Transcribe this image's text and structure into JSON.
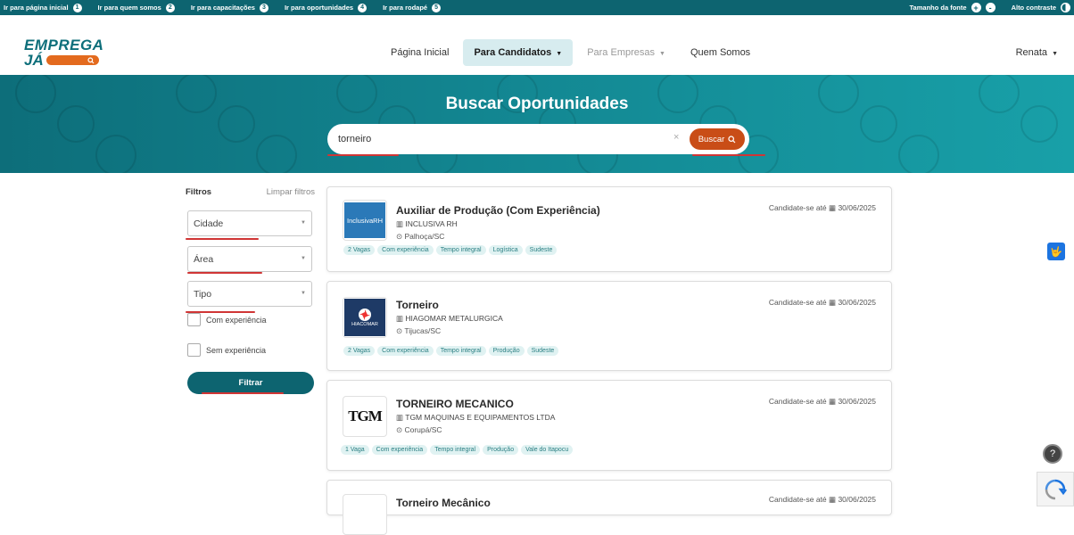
{
  "accessibility_bar": {
    "links": [
      {
        "label": "Ir para página inicial",
        "num": "1"
      },
      {
        "label": "Ir para quem somos",
        "num": "2"
      },
      {
        "label": "Ir para capacitações",
        "num": "3"
      },
      {
        "label": "Ir para oportunidades",
        "num": "4"
      },
      {
        "label": "Ir para rodapé",
        "num": "5"
      }
    ],
    "font_size_label": "Tamanho da fonte",
    "font_increase": "+",
    "font_decrease": "-",
    "contrast_label": "Alto contraste"
  },
  "header": {
    "logo_top": "EMPREGA",
    "logo_bottom": "JÁ",
    "nav": [
      {
        "label": "Página Inicial",
        "caret": ""
      },
      {
        "label": "Para Candidatos",
        "caret": "▼"
      },
      {
        "label": "Para Empresas",
        "caret": "▼"
      },
      {
        "label": "Quem Somos",
        "caret": ""
      }
    ],
    "user": "Renata",
    "user_caret": "▼"
  },
  "hero": {
    "title": "Buscar Oportunidades",
    "search_value": "torneiro",
    "clear_icon": "×",
    "search_button": "Buscar"
  },
  "filters": {
    "title": "Filtros",
    "clear": "Limpar filtros",
    "city": "Cidade",
    "area": "Área",
    "type": "Tipo",
    "with_experience": "Com experiência",
    "without_experience": "Sem experiência",
    "button": "Filtrar"
  },
  "deadline_label": "Candidate-se até",
  "jobs": [
    {
      "title": "Auxiliar de Produção (Com Experiência)",
      "company": "INCLUSIVA RH",
      "city": "Palhoça/SC",
      "deadline": "30/06/2025",
      "logo_text": "InclusivaRH",
      "tags": [
        "2 Vagas",
        "Com experiência",
        "Tempo integral",
        "Logística",
        "Sudeste"
      ]
    },
    {
      "title": "Torneiro",
      "company": "HIAGOMAR METALURGICA",
      "city": "Tijucas/SC",
      "deadline": "30/06/2025",
      "logo_text": "HIACOMAR",
      "tags": [
        "2 Vagas",
        "Com experiência",
        "Tempo integral",
        "Produção",
        "Sudeste"
      ]
    },
    {
      "title": "TORNEIRO MECANICO",
      "company": "TGM MAQUINAS E EQUIPAMENTOS LTDA",
      "city": "Corupá/SC",
      "deadline": "30/06/2025",
      "logo_text": "TGM",
      "tags": [
        "1 Vaga",
        "Com experiência",
        "Tempo integral",
        "Produção",
        "Vale do Itapocu"
      ]
    },
    {
      "title": "Torneiro Mecânico",
      "company": "",
      "city": "",
      "deadline": "30/06/2025",
      "logo_text": "",
      "tags": []
    }
  ],
  "colors": {
    "primary": "#0d6470",
    "accent": "#c94d17",
    "tag_bg": "#e0f2f2",
    "highlight_underline": "#d03535"
  },
  "icons": {
    "help": "?",
    "accessibility": "🤟"
  }
}
